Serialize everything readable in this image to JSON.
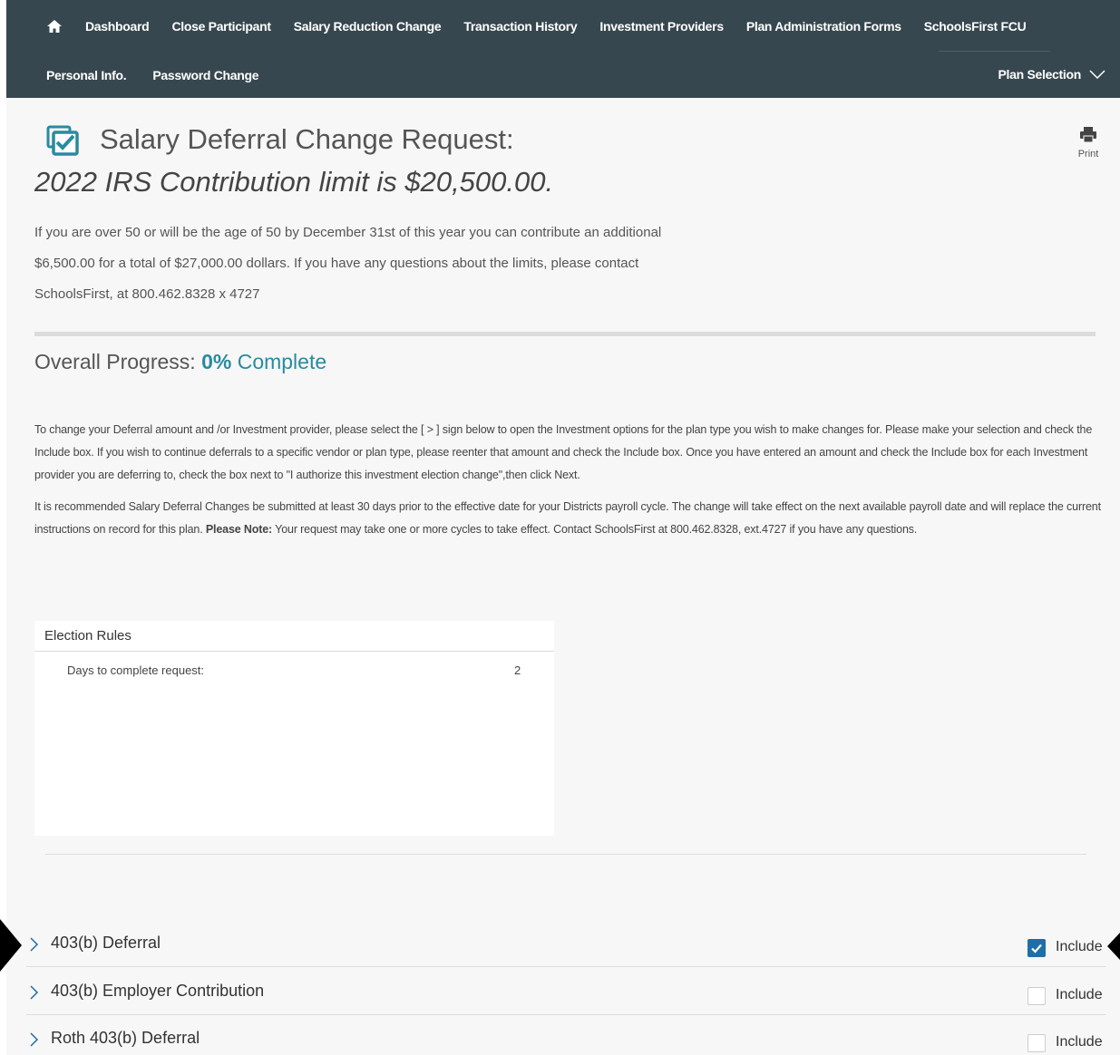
{
  "nav": {
    "row1": [
      "Dashboard",
      "Close Participant",
      "Salary Reduction Change",
      "Transaction History",
      "Investment Providers",
      "Plan Administration Forms",
      "SchoolsFirst FCU"
    ],
    "row2": [
      "Personal Info.",
      "Password Change"
    ],
    "plan_selection": "Plan Selection"
  },
  "header": {
    "title": "Salary Deferral Change Request:",
    "subtitle": "2022 IRS Contribution limit is $20,500.00.",
    "print_label": "Print",
    "intro_lines": [
      "If you are over 50 or will be the age of 50 by December 31st of this year you can contribute an additional",
      "$6,500.00 for a total of $27,000.00 dollars. If you have any questions about the limits, please contact",
      "SchoolsFirst, at 800.462.8328 x 4727"
    ]
  },
  "progress": {
    "label": "Overall Progress: ",
    "percent": "0%",
    "suffix": " Complete",
    "value": 0
  },
  "instructions": {
    "p1": "To change your Deferral amount and /or Investment provider, please select the [ > ] sign below to open the Investment options for the plan type you wish to make changes for. Please make your selection and check the Include box. If you wish to continue deferrals to a specific vendor or plan type, please reenter that amount and check the Include box. Once you have entered an amount and check the Include box for each Investment provider you are deferring to, check the box next to \"I authorize this investment election change\",then click Next.",
    "p2_start": "It is recommended Salary Deferral Changes be submitted at least 30 days prior to the effective date for your Districts payroll cycle. The change will take effect on the next available payroll date and will replace the current instructions on record for this plan. ",
    "p2_bold": "Please Note:",
    "p2_end": " Your request may take one or more cycles to take effect. Contact SchoolsFirst at 800.462.8328, ext.4727 if you have any questions."
  },
  "rules": {
    "title": "Election Rules",
    "rows": [
      {
        "label": "Days to complete request:",
        "value": "2"
      }
    ]
  },
  "plans": [
    {
      "name": "403(b) Deferral",
      "include_label": "Include",
      "checked": true
    },
    {
      "name": "403(b) Employer Contribution",
      "include_label": "Include",
      "checked": false
    },
    {
      "name": "Roth 403(b) Deferral",
      "include_label": "Include",
      "checked": false
    }
  ],
  "colors": {
    "nav_bg": "#37474f",
    "accent": "#2a8a9e",
    "checkbox": "#1e6fa8"
  }
}
